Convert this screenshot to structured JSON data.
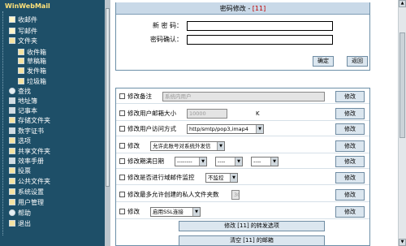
{
  "sidebar": {
    "title": "WinWebMail",
    "items": [
      {
        "label": "收邮件",
        "icon": "inbox-icon"
      },
      {
        "label": "写邮件",
        "icon": "compose-icon"
      },
      {
        "label": "文件夹",
        "icon": "folder-icon"
      },
      {
        "label": "收件箱",
        "icon": "inbox-folder-icon"
      },
      {
        "label": "草稿箱",
        "icon": "drafts-icon"
      },
      {
        "label": "发件箱",
        "icon": "outbox-icon"
      },
      {
        "label": "垃圾箱",
        "icon": "trash-icon"
      },
      {
        "label": "查找",
        "icon": "search-icon"
      },
      {
        "label": "地址簿",
        "icon": "address-book-icon"
      },
      {
        "label": "记事本",
        "icon": "notepad-icon"
      },
      {
        "label": "存储文件夹",
        "icon": "storage-folder-icon"
      },
      {
        "label": "数字证书",
        "icon": "certificate-icon"
      },
      {
        "label": "选项",
        "icon": "options-icon"
      },
      {
        "label": "共享文件夹",
        "icon": "shared-folder-icon"
      },
      {
        "label": "效率手册",
        "icon": "handbook-icon"
      },
      {
        "label": "投票",
        "icon": "vote-icon"
      },
      {
        "label": "公共文件夹",
        "icon": "public-folder-icon"
      },
      {
        "label": "系统设置",
        "icon": "system-settings-icon"
      },
      {
        "label": "用户管理",
        "icon": "user-management-icon"
      },
      {
        "label": "帮助",
        "icon": "help-icon"
      },
      {
        "label": "退出",
        "icon": "logout-icon"
      }
    ]
  },
  "password_panel": {
    "title": "密码修改 - ",
    "user_num": "[11]",
    "new_password_label": "新 密 码：",
    "confirm_password_label": "密码确认：",
    "new_password_value": "",
    "confirm_password_value": "",
    "ok_label": "确定",
    "back_label": "返回"
  },
  "options": {
    "edit_label": "修改",
    "rows": [
      {
        "label": "修改备注",
        "field": "系统内用户",
        "field_gray": true
      },
      {
        "label": "修改用户邮箱大小",
        "field": "10000",
        "field_gray": true,
        "unit": "K"
      },
      {
        "label": "修改用户访问方式",
        "select": "http/smtp/pop3,imap4"
      },
      {
        "label": "修改",
        "select": "允许此账号对系统外发信",
        "select_gray": false
      },
      {
        "label": "修改期满日期",
        "selects": [
          "--------",
          "----",
          "----"
        ]
      },
      {
        "label": "修改是否进行域邮件监控",
        "select": "不监控"
      },
      {
        "label": "修改最多允许创建的私人文件夹数",
        "field": "30",
        "field_gray": true
      },
      {
        "label": "修改",
        "select": "启用SSL连接"
      }
    ],
    "forward_button": "修改 [11] 的转发选项",
    "clear_button": "清空 [11] 的邮箱"
  }
}
